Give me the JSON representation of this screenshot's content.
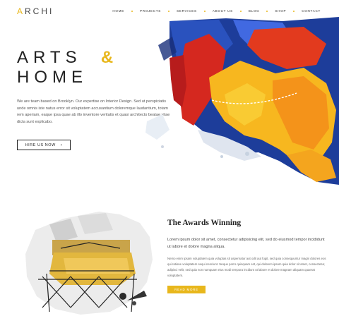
{
  "brand": {
    "logo_first": "A",
    "logo_rest": "RCHI",
    "accent": "#e8b71c"
  },
  "nav": {
    "items": [
      "HOME",
      "PROJECTS",
      "SERVICES",
      "ABOUT US",
      "BLOG",
      "SHOP",
      "CONTACT"
    ]
  },
  "hero": {
    "title_word1": "ARTS",
    "title_amp": "&",
    "title_word2": "HOME",
    "paragraph": "We are team based on Brooklyn. Our expertise on Interior Design. Sed ut perspiciatis unde omnis iste natus error sit voluptatem accusantium doloremque laudantium, totam rem aperiam, eaque ipsa quae ab illo inventore veritatis et quasi architecto beatae vitae dicta sunt explicabo.",
    "button_label": "HIRE US NOW",
    "button_icon": "chevron-right-icon"
  },
  "awards": {
    "title": "The Awards Winning",
    "lead": "Lorem ipsum dolor sit amet, consectetur adipisicing elit, sed do eiusmod tempor incididunt ut labore et dolore magna aliqua.",
    "body": "Nemo enim ipsam voluptatem quia voluptas sit aspernatur aut odit aut fugit, sed quia consequuntur magni dolores eos qui ratione voluptatem sequi nesciunt. Neque porro quisquam est, qui dolorem ipsum quia dolor sit amet, consectetur, adipisci velit, sed quia non numquam eius modi tempora incidunt ut labore et dolore magnam aliquam quaerat voluptatem.",
    "button_label": "READ MORE"
  }
}
